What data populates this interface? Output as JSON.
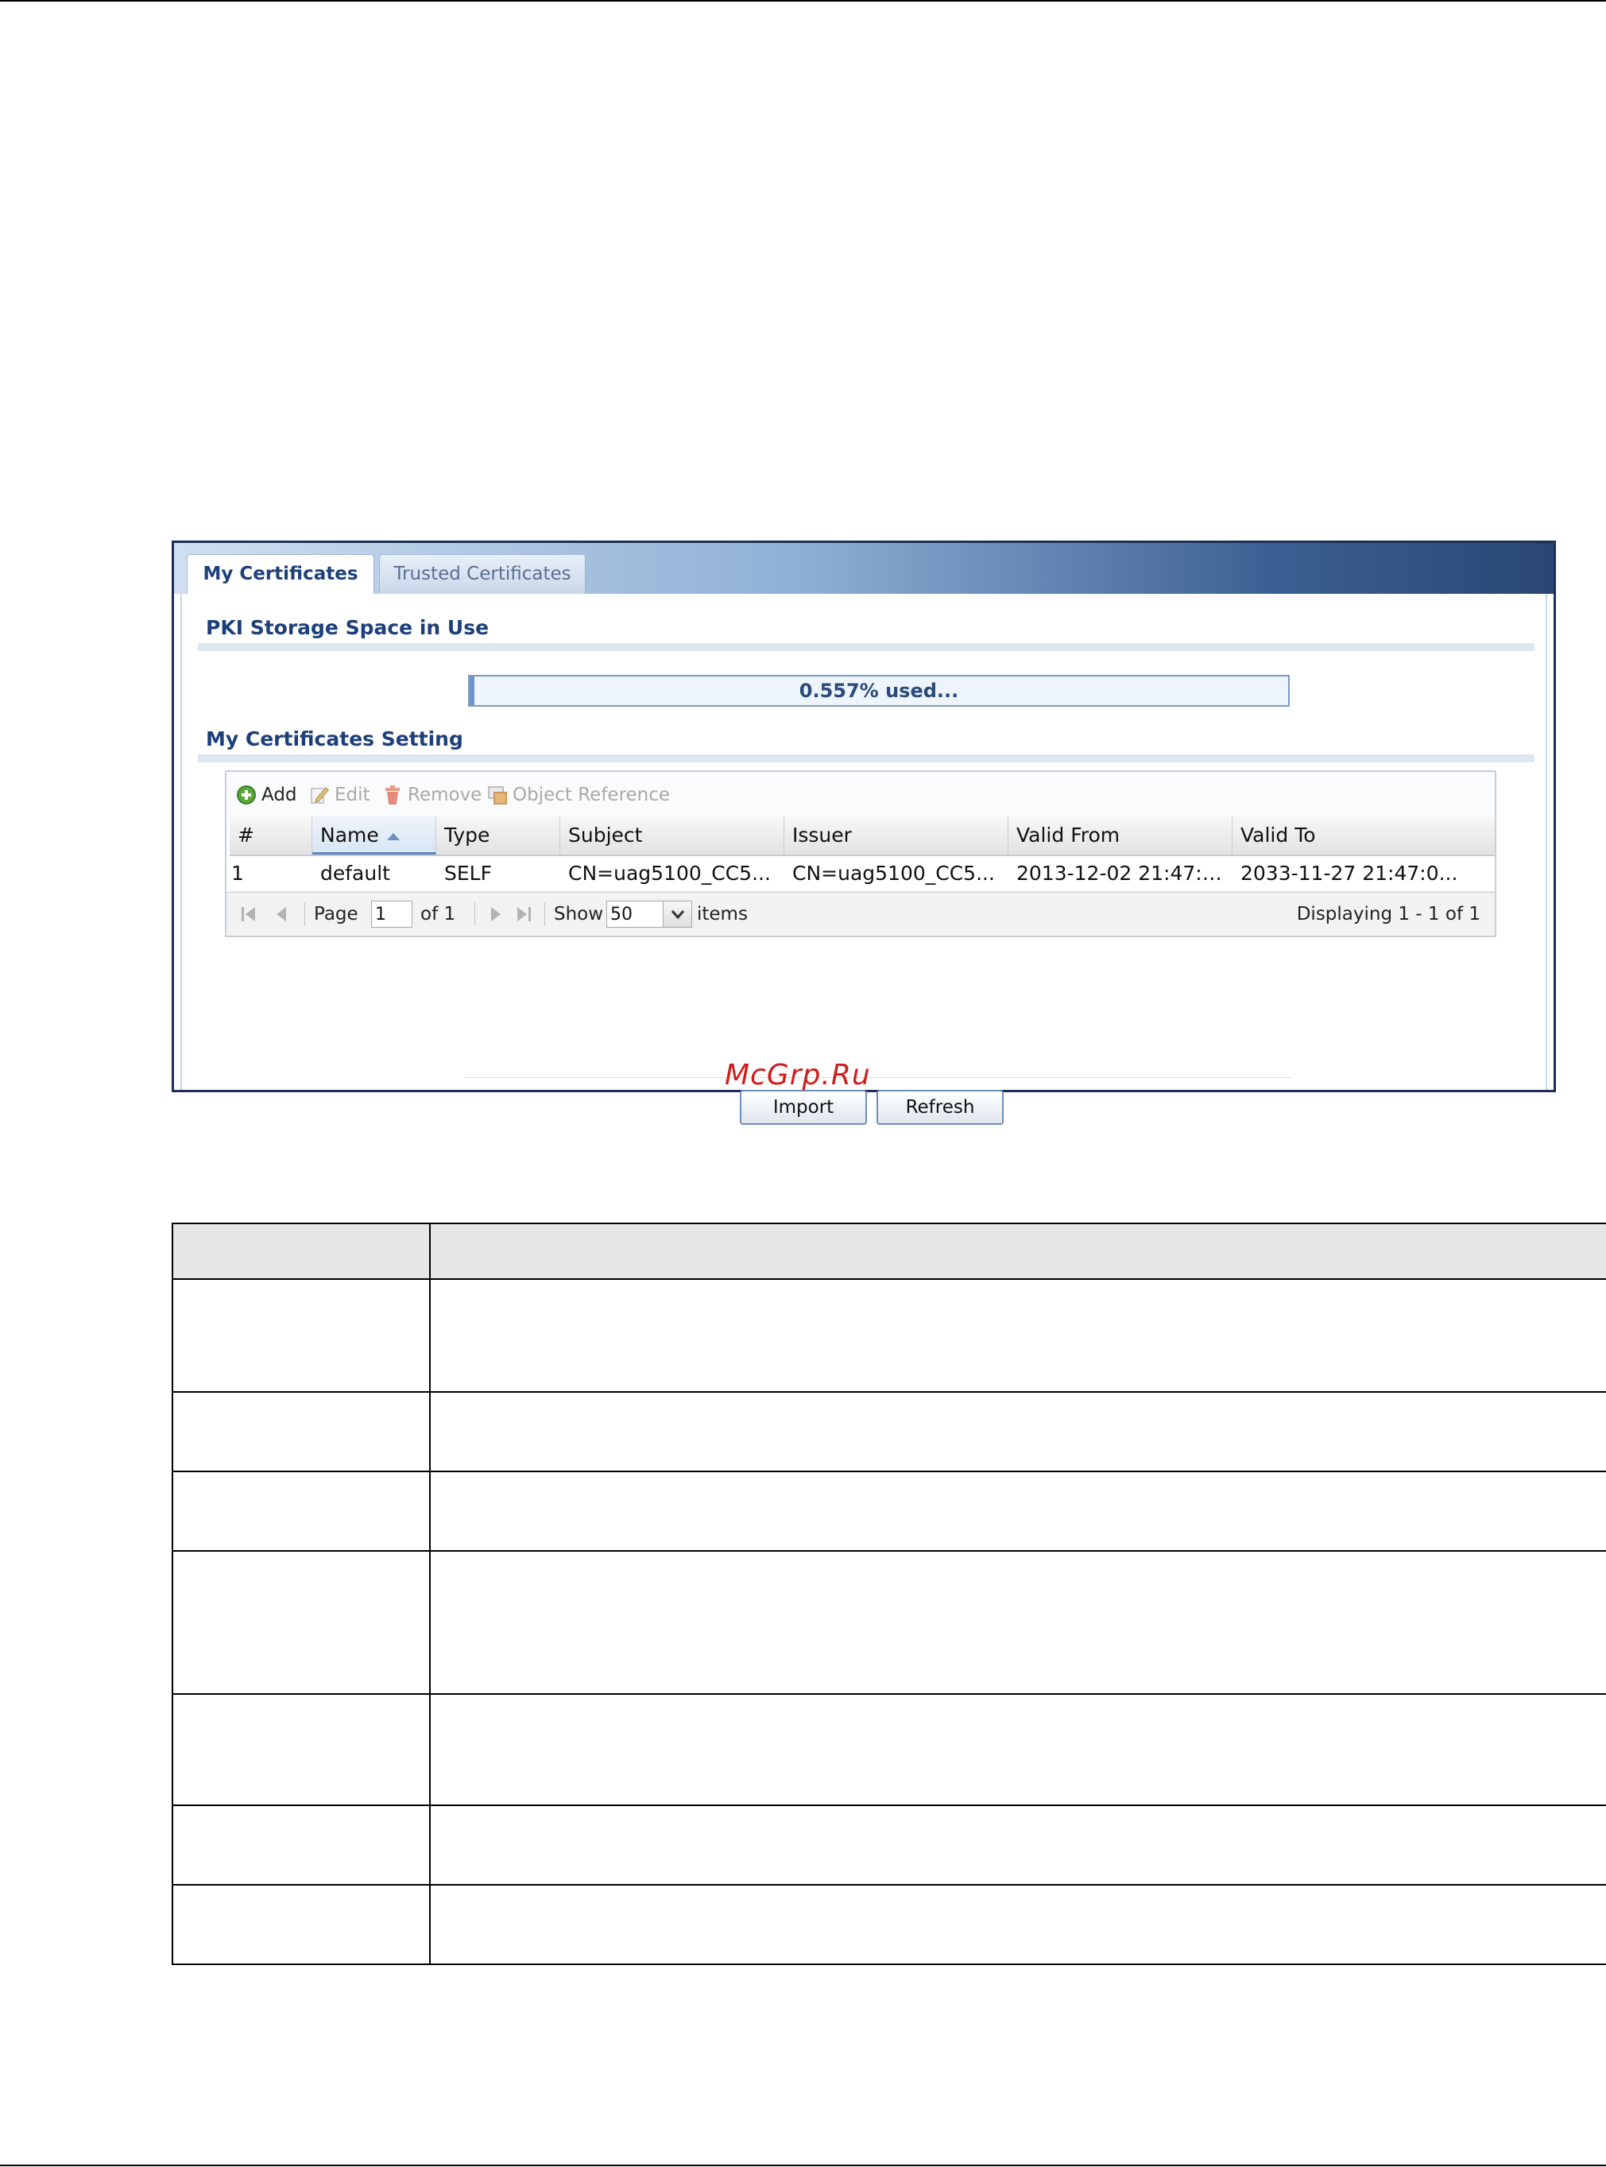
{
  "tabs": [
    {
      "label": "My Certificates",
      "active": true
    },
    {
      "label": "Trusted Certificates",
      "active": false
    }
  ],
  "storage": {
    "title": "PKI Storage Space in Use",
    "used_percent": 0.557,
    "used_text": "0.557% used..."
  },
  "settings": {
    "title": "My Certificates Setting",
    "toolbar": {
      "add": "Add",
      "edit": "Edit",
      "remove": "Remove",
      "object_reference": "Object Reference"
    },
    "columns": {
      "num": "#",
      "name": "Name",
      "type": "Type",
      "subject": "Subject",
      "issuer": "Issuer",
      "valid_from": "Valid From",
      "valid_to": "Valid To"
    },
    "rows": [
      {
        "num": "1",
        "name": "default",
        "type": "SELF",
        "subject": "CN=uag5100_CC5...",
        "issuer": "CN=uag5100_CC5...",
        "valid_from": "2013-12-02 21:47:0...",
        "valid_to": "2033-11-27 21:47:0..."
      }
    ],
    "pager": {
      "page_label": "Page",
      "page_value": "1",
      "of_label": "of 1",
      "show_label": "Show",
      "show_value": "50",
      "items_label": "items",
      "displaying": "Displaying 1 - 1 of 1"
    }
  },
  "buttons": {
    "import": "Import",
    "refresh": "Refresh"
  },
  "watermark": "McGrp.Ru",
  "colors": {
    "accent": "#1d3f79",
    "tabbar_dark": "#2a4673",
    "watermark": "#d11c1c"
  }
}
